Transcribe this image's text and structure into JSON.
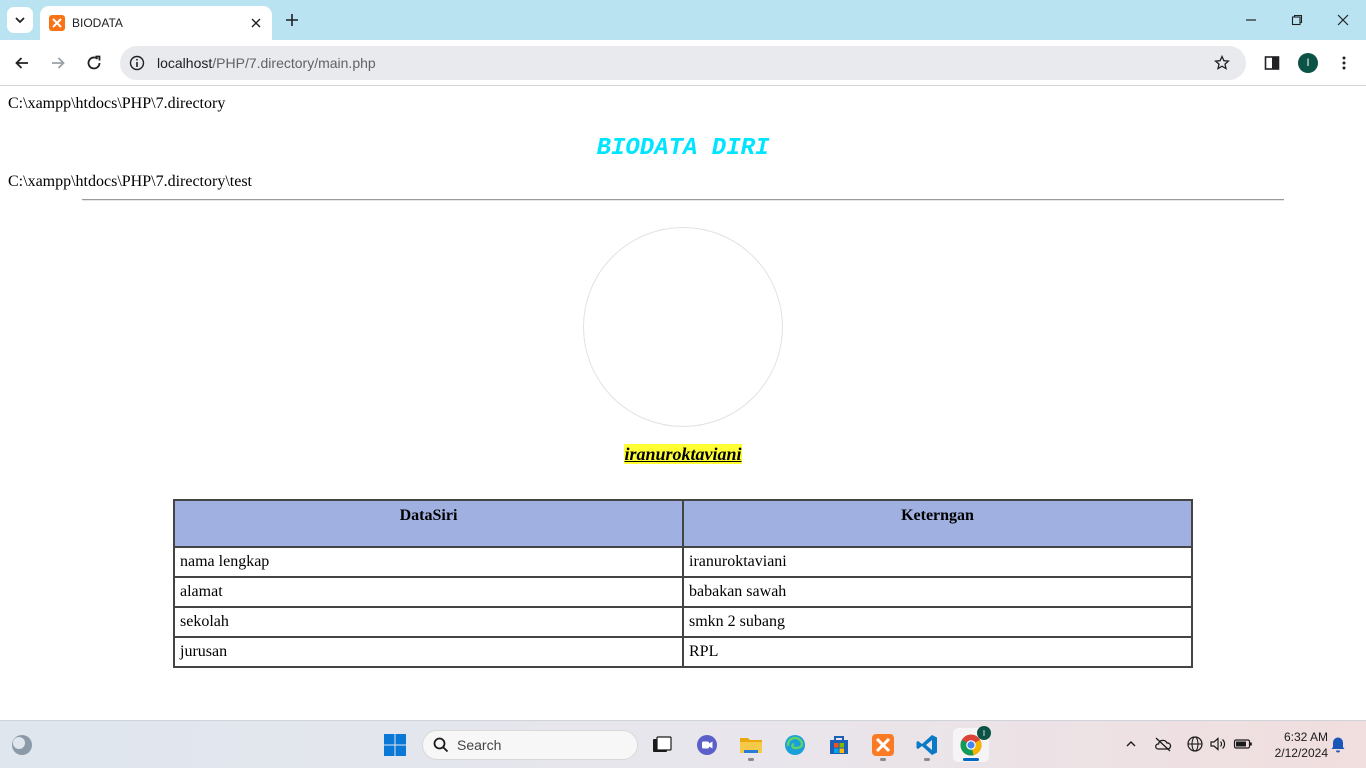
{
  "browser": {
    "tab_title": "BIODATA",
    "url_host": "localhost",
    "url_path": "/PHP/7.directory/main.php",
    "profile_initial": "I"
  },
  "page": {
    "path_top": "C:\\xampp\\htdocs\\PHP\\7.directory",
    "heading": "BIODATA DIRI",
    "path_sub": "C:\\xampp\\htdocs\\PHP\\7.directory\\test",
    "name": "iranuroktaviani",
    "heading_color": "#00e5ff",
    "table": {
      "headers": [
        "DataSiri",
        "Keterngan"
      ],
      "rows": [
        [
          "nama lengkap",
          "iranuroktaviani"
        ],
        [
          "alamat",
          "babakan sawah"
        ],
        [
          "sekolah",
          "smkn 2 subang"
        ],
        [
          "jurusan",
          "RPL"
        ]
      ]
    }
  },
  "taskbar": {
    "search_placeholder": "Search",
    "chrome_badge": "I",
    "time": "6:32 AM",
    "date": "2/12/2024"
  }
}
